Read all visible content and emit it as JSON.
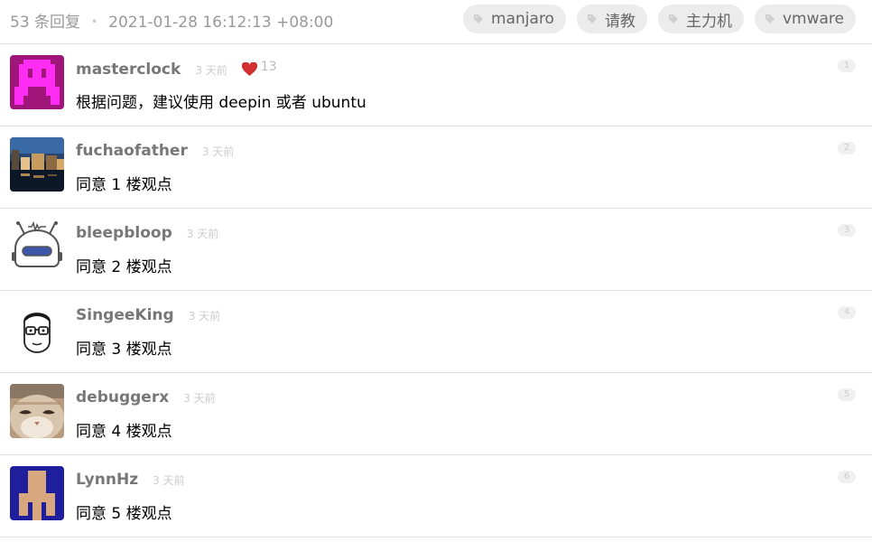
{
  "header": {
    "reply_count": "53 条回复",
    "dot": "•",
    "timestamp": "2021-01-28 16:12:13 +08:00",
    "tags": [
      "manjaro",
      "请教",
      "主力机",
      "vmware"
    ]
  },
  "colors": {
    "tag_bg": "#ececec",
    "username": "#777777",
    "heart": "#d0302f",
    "divider": "#e2e2e2"
  },
  "replies": [
    {
      "user": "masterclock",
      "ago": "3 天前",
      "likes": "13",
      "content": "根据问题，建议使用 deepin 或者 ubuntu",
      "floor": "1",
      "avatar": "pixel-monster-avatar"
    },
    {
      "user": "fuchaofather",
      "ago": "3 天前",
      "content": "同意 1 楼观点",
      "floor": "2",
      "avatar": "night-city-photo-avatar"
    },
    {
      "user": "bleepbloop",
      "ago": "3 天前",
      "content": "同意 2 楼观点",
      "floor": "3",
      "avatar": "robot-avatar"
    },
    {
      "user": "SingeeKing",
      "ago": "3 天前",
      "content": "同意 3 楼观点",
      "floor": "4",
      "avatar": "cartoon-face-avatar"
    },
    {
      "user": "debuggerx",
      "ago": "3 天前",
      "content": "同意 4 楼观点",
      "floor": "5",
      "avatar": "cat-photo-avatar"
    },
    {
      "user": "LynnHz",
      "ago": "3 天前",
      "content": "同意 5 楼观点",
      "floor": "6",
      "avatar": "pixel-figure-avatar"
    }
  ]
}
